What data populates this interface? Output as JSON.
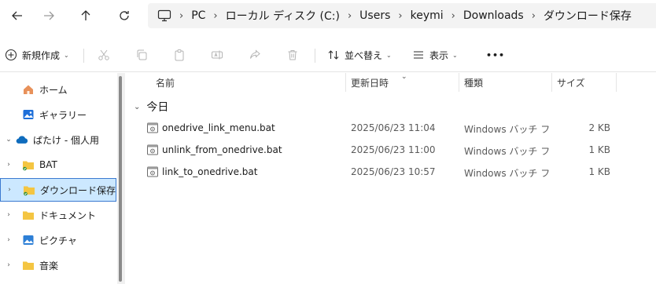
{
  "nav": {
    "back_icon": "arrow-left-icon",
    "forward_icon": "arrow-right-icon",
    "up_icon": "arrow-up-icon",
    "refresh_icon": "refresh-icon"
  },
  "breadcrumb": {
    "icon": "computer-icon",
    "parts": [
      "PC",
      "ローカル ディスク (C:)",
      "Users",
      "keymi",
      "Downloads",
      "ダウンロード保存"
    ]
  },
  "commandbar": {
    "new_label": "新規作成",
    "sort_label": "並べ替え",
    "view_label": "表示",
    "more_label": "•••"
  },
  "sidebar": {
    "items": [
      {
        "label": "ホーム",
        "icon": "home-icon"
      },
      {
        "label": "ギャラリー",
        "icon": "gallery-icon"
      },
      {
        "label": "ぱたけ - 個人用",
        "icon": "onedrive-cloud-icon"
      },
      {
        "label": "BAT",
        "icon": "folder-icon"
      },
      {
        "label": "ダウンロード保存",
        "icon": "folder-icon"
      },
      {
        "label": "ドキュメント",
        "icon": "folder-icon"
      },
      {
        "label": "ピクチャ",
        "icon": "pictures-icon"
      },
      {
        "label": "音楽",
        "icon": "folder-icon"
      }
    ]
  },
  "columns": {
    "name": "名前",
    "date": "更新日時",
    "type": "種類",
    "size": "サイズ"
  },
  "group": {
    "label": "今日"
  },
  "files": [
    {
      "name": "onedrive_link_menu.bat",
      "date": "2025/06/23 11:04",
      "type": "Windows バッチ ファイル",
      "size": "2 KB"
    },
    {
      "name": "unlink_from_onedrive.bat",
      "date": "2025/06/23 11:00",
      "type": "Windows バッチ ファイル",
      "size": "1 KB"
    },
    {
      "name": "link_to_onedrive.bat",
      "date": "2025/06/23 10:57",
      "type": "Windows バッチ ファイル",
      "size": "1 KB"
    }
  ],
  "colors": {
    "selection_bg": "#cce8ff",
    "selection_border": "#3b7ad0",
    "folder_yellow": "#f4c542",
    "onedrive_blue": "#0f6cbd"
  }
}
